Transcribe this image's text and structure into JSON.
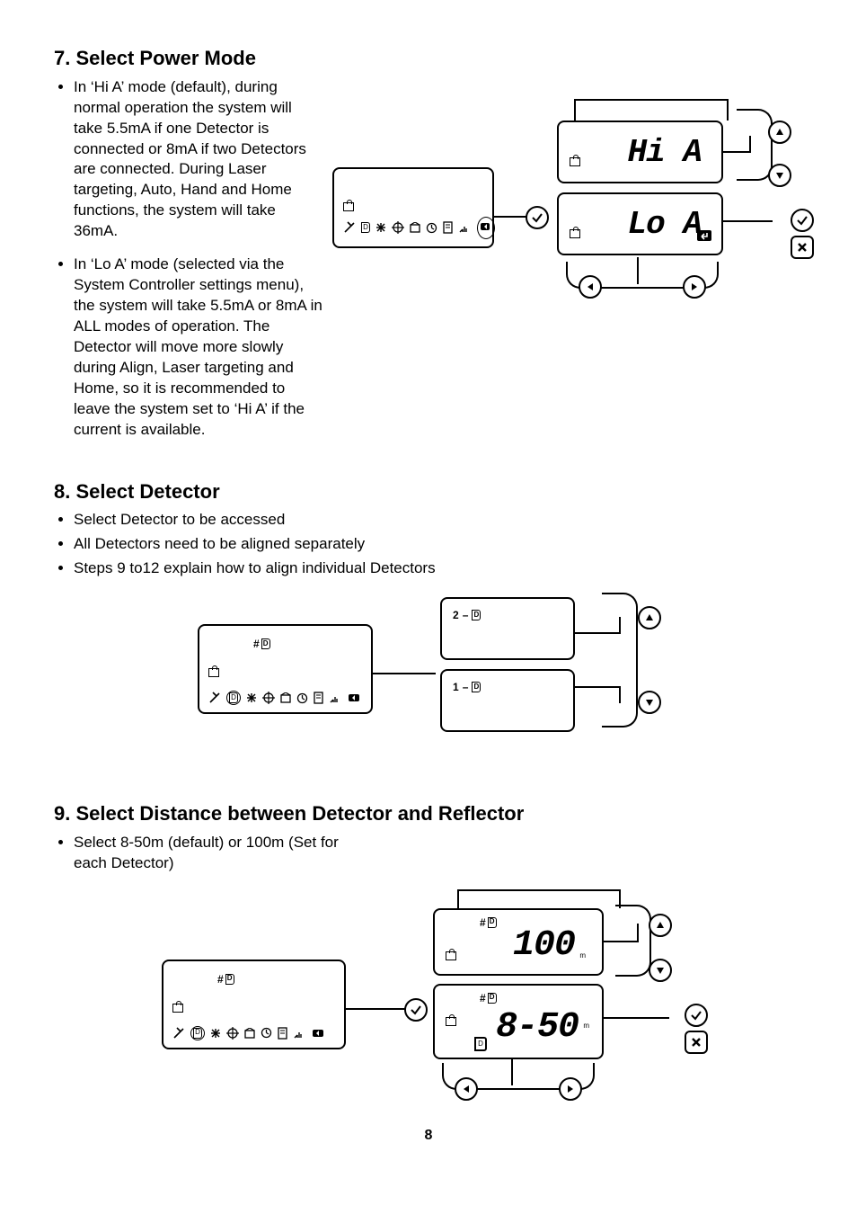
{
  "section7": {
    "heading": "7. Select Power Mode",
    "bullet1": "In ‘Hi A’ mode (default), during normal operation the system will take 5.5mA if one Detector is connected or 8mA if two Detectors are connected. During Laser targeting, Auto, Hand and Home functions, the system will take 36mA.",
    "bullet2": "In ‘Lo A’ mode (selected via the System Controller settings menu), the system will take 5.5mA or 8mA in ALL modes of operation. The Detector will move more slowly during Align, Laser targeting and Home, so it is recommended to leave the system set to ‘Hi A’ if the current is available.",
    "lcd_hi": "Hi  A",
    "lcd_lo": "Lo  A"
  },
  "section8": {
    "heading": "8. Select Detector",
    "bullet1": "Select Detector to be accessed",
    "bullet2": "All Detectors need to be aligned separately",
    "bullet3": "Steps 9 to12 explain how to align individual Detectors",
    "badge_hash": "#",
    "badge_1": "1",
    "badge_2": "2"
  },
  "section9": {
    "heading": "9. Select Distance between Detector and Reflector",
    "bullet1": "Select 8-50m (default) or 100m (Set for each Detector)",
    "badge_hash": "#",
    "val_100": "100",
    "val_850": "8-50"
  },
  "buttons": {
    "up": "up-button",
    "down": "down-button",
    "left": "left-button",
    "right": "right-button",
    "ok": "ok-button",
    "cancel": "cancel-button",
    "back": "back-button"
  },
  "page_number": "8"
}
